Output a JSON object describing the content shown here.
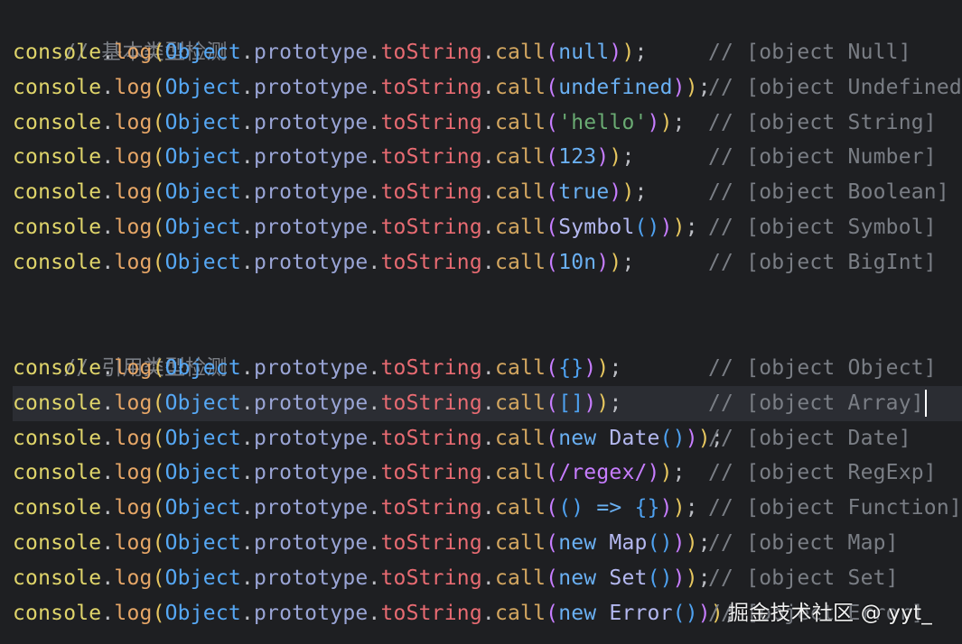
{
  "comments": {
    "basic_header": "// 基本类型检测",
    "reference_header": "// 引用类型检测"
  },
  "prefix": {
    "console": "console",
    "dot": ".",
    "log": "log",
    "open": "(",
    "object": "Object",
    "prototype": "prototype",
    "tostring": "toString",
    "call": "call"
  },
  "basic_lines": [
    {
      "arg": "null",
      "tail": "));",
      "result": "// [object Null]"
    },
    {
      "arg": "undefined",
      "tail": "));",
      "result": "// [object Undefined]"
    },
    {
      "arg": "'hello'",
      "tail": "));",
      "result": "// [object String]"
    },
    {
      "arg": "123",
      "tail": "));",
      "result": "// [object Number]"
    },
    {
      "arg": "true",
      "tail": "));",
      "result": "// [object Boolean]"
    },
    {
      "arg": "Symbol()",
      "tail": "));",
      "result": "// [object Symbol]"
    },
    {
      "arg": "10n",
      "tail": "));",
      "result": "// [object BigInt]"
    }
  ],
  "reference_lines": [
    {
      "arg": "{}",
      "tail": "));",
      "result": "// [object Object]"
    },
    {
      "arg": "[]",
      "tail": "));",
      "result": "// [object Array]"
    },
    {
      "arg": "new Date()",
      "tail": "));",
      "result": "// [object Date]"
    },
    {
      "arg": "/regex/",
      "tail": "));",
      "result": "// [object RegExp]"
    },
    {
      "arg": "() => {}",
      "tail": "));",
      "result": "// [object Function]"
    },
    {
      "arg": "new Map()",
      "tail": "));",
      "result": "// [object Map]"
    },
    {
      "arg": "new Set()",
      "tail": "));",
      "result": "// [object Set]"
    },
    {
      "arg": "new Error()",
      "tail": "));",
      "result": "// [object Error]"
    }
  ],
  "watermark": "掘金技术社区 @ yyt_"
}
